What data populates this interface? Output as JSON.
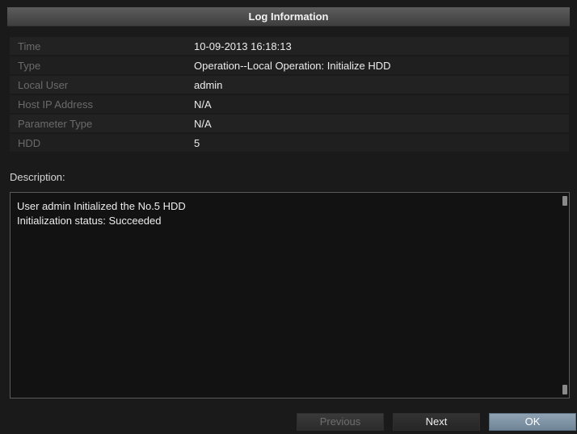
{
  "dialog": {
    "title": "Log Information"
  },
  "info": {
    "rows": [
      {
        "label": "Time",
        "value": "10-09-2013 16:18:13"
      },
      {
        "label": "Type",
        "value": "Operation--Local Operation: Initialize HDD"
      },
      {
        "label": "Local User",
        "value": "admin"
      },
      {
        "label": "Host IP Address",
        "value": "N/A"
      },
      {
        "label": "Parameter Type",
        "value": "N/A"
      },
      {
        "label": "HDD",
        "value": "5"
      }
    ]
  },
  "description": {
    "label": "Description:",
    "lines": [
      "User admin Initialized the No.5 HDD",
      "Initialization status: Succeeded"
    ]
  },
  "buttons": {
    "previous": "Previous",
    "next": "Next",
    "ok": "OK"
  },
  "colors": {
    "title_bar": "#4a4a4a",
    "ok_button": "#7e93a5",
    "disabled_text": "#6e6e6e"
  }
}
